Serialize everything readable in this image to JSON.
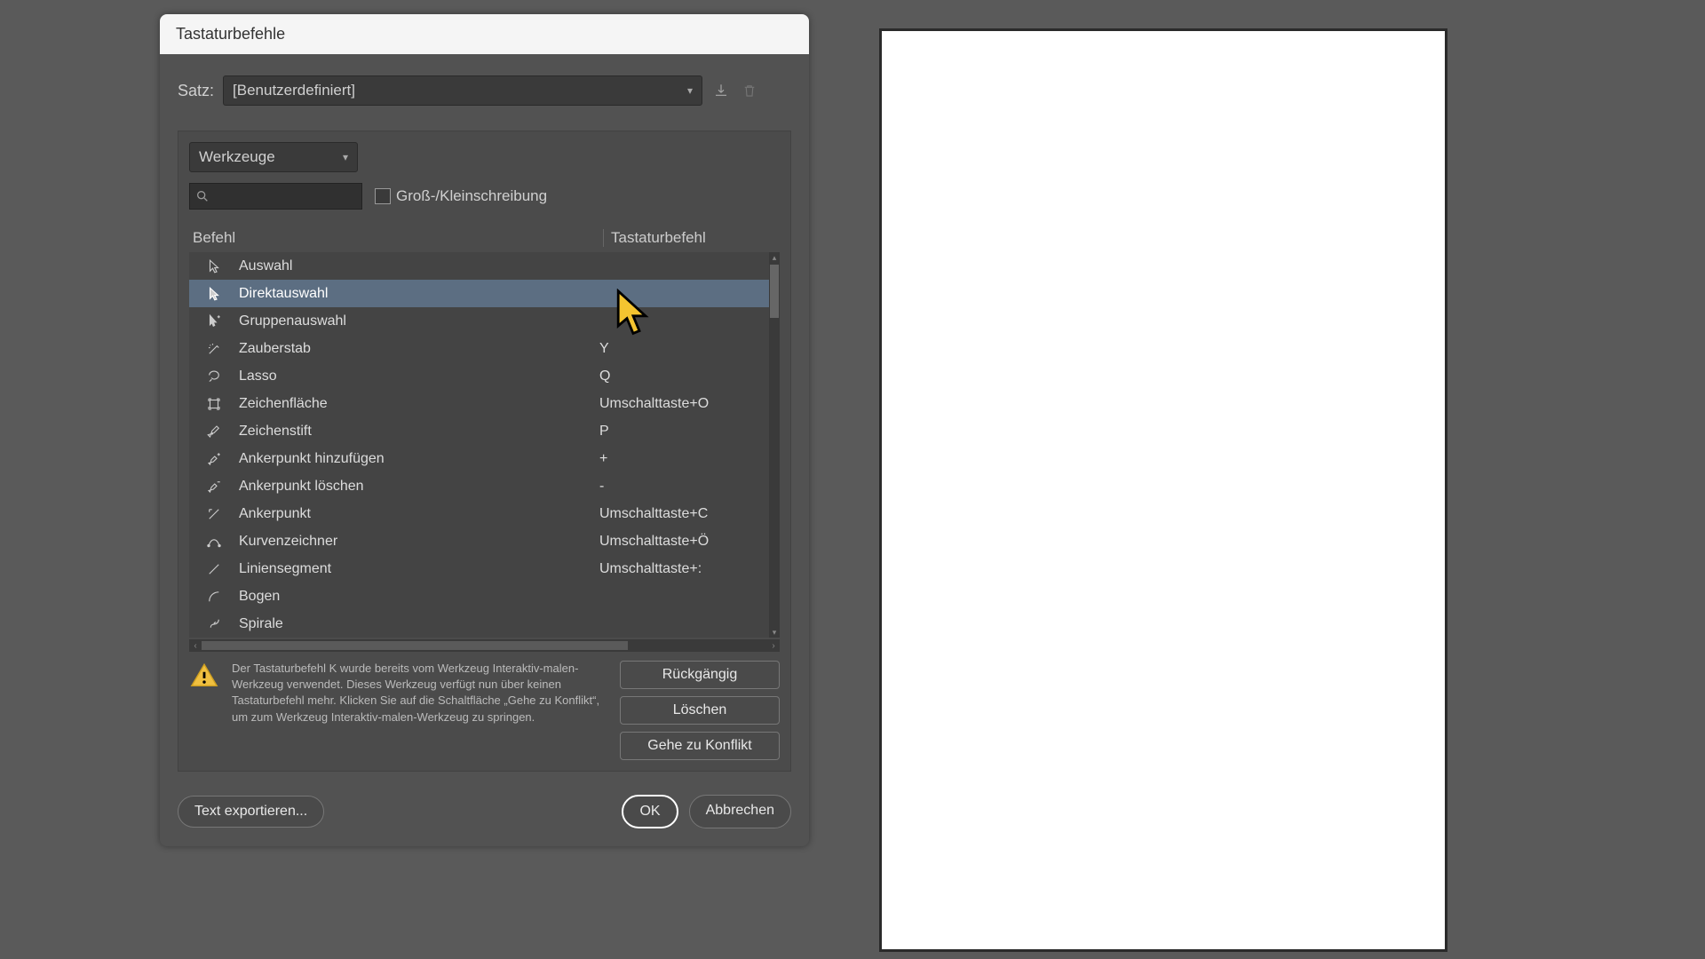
{
  "dialog": {
    "title": "Tastaturbefehle",
    "set_label": "Satz:",
    "set_value": "[Benutzerdefiniert]",
    "category_value": "Werkzeuge",
    "case_label": "Groß-/Kleinschreibung",
    "col_command": "Befehl",
    "col_shortcut": "Tastaturbefehl",
    "rows": [
      {
        "icon": "pointer-outline",
        "cmd": "Auswahl",
        "key": ""
      },
      {
        "icon": "pointer-solid",
        "cmd": "Direktauswahl",
        "key": "",
        "selected": true
      },
      {
        "icon": "pointer-plus",
        "cmd": "Gruppenauswahl",
        "key": ""
      },
      {
        "icon": "wand",
        "cmd": "Zauberstab",
        "key": "Y"
      },
      {
        "icon": "lasso",
        "cmd": "Lasso",
        "key": "Q"
      },
      {
        "icon": "artboard",
        "cmd": "Zeichenfläche",
        "key": "Umschalttaste+O"
      },
      {
        "icon": "pen",
        "cmd": "Zeichenstift",
        "key": "P"
      },
      {
        "icon": "pen-plus",
        "cmd": "Ankerpunkt hinzufügen",
        "key": "+"
      },
      {
        "icon": "pen-minus",
        "cmd": "Ankerpunkt löschen",
        "key": "-"
      },
      {
        "icon": "anchor-convert",
        "cmd": "Ankerpunkt",
        "key": "Umschalttaste+C"
      },
      {
        "icon": "curvature",
        "cmd": "Kurvenzeichner",
        "key": "Umschalttaste+Ö"
      },
      {
        "icon": "line",
        "cmd": "Liniensegment",
        "key": "Umschalttaste+:"
      },
      {
        "icon": "arc",
        "cmd": "Bogen",
        "key": ""
      },
      {
        "icon": "spiral",
        "cmd": "Spirale",
        "key": ""
      }
    ],
    "warning": "Der Tastaturbefehl K wurde bereits vom Werkzeug Interaktiv-malen-Werkzeug verwendet. Dieses Werkzeug verfügt nun über keinen Tastaturbefehl mehr. Klicken Sie auf die Schaltfläche „Gehe zu Konflikt“, um zum Werkzeug Interaktiv-malen-Werkzeug zu springen.",
    "btn_undo": "Rückgängig",
    "btn_clear": "Löschen",
    "btn_goto": "Gehe zu Konflikt",
    "btn_export": "Text exportieren...",
    "btn_ok": "OK",
    "btn_cancel": "Abbrechen"
  }
}
